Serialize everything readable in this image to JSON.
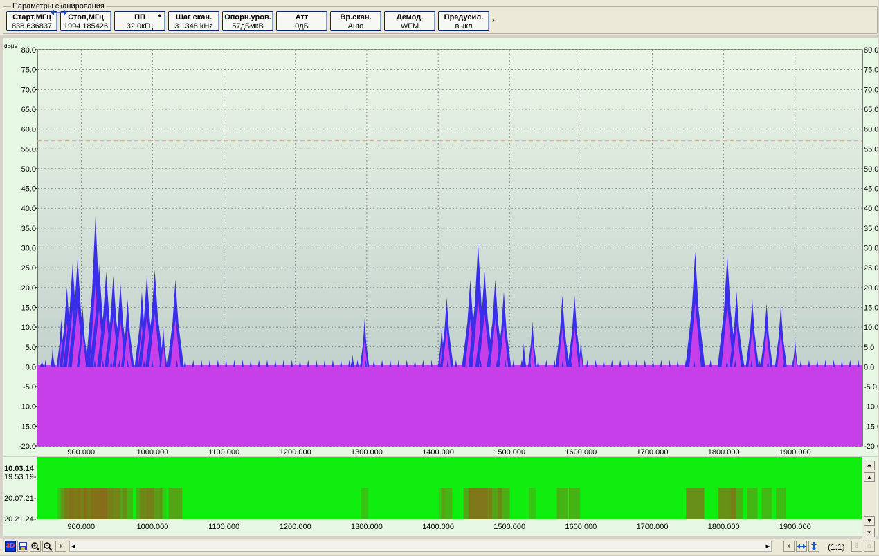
{
  "panel": {
    "title": "Параметры сканирования",
    "buttons": [
      {
        "name": "Старт,МГц",
        "value": "838.636837"
      },
      {
        "name": "Стоп,МГц",
        "value": "1994.185426"
      },
      {
        "name": "ПП",
        "value": "32.0кГц",
        "marker": "*"
      },
      {
        "name": "Шаг скан.",
        "value": "31.348 kHz"
      },
      {
        "name": "Опорн.уров.",
        "value": "57дБмкВ"
      },
      {
        "name": "Атт",
        "value": "0дБ"
      },
      {
        "name": "Вр.скан.",
        "value": "Auto"
      },
      {
        "name": "Демод.",
        "value": "WFM"
      },
      {
        "name": "Предусил.",
        "value": "выкл"
      }
    ],
    "more_glyph": "›"
  },
  "spectrum": {
    "unit": "dBµV",
    "y_ticks": [
      "80.0",
      "75.0",
      "70.0",
      "65.0",
      "60.0",
      "55.0",
      "50.0",
      "45.0",
      "40.0",
      "35.0",
      "30.0",
      "25.0",
      "20.0",
      "15.0",
      "10.0",
      "5.0",
      "0.0",
      "-5.0",
      "-10.0",
      "-15.0",
      "-20.0"
    ],
    "x_ticks": [
      "900.000",
      "1000.000",
      "1100.000",
      "1200.000",
      "1300.000",
      "1400.000",
      "1500.000",
      "1600.000",
      "1700.000",
      "1800.000",
      "1900.000"
    ],
    "reference_level": 57
  },
  "chart_data": {
    "type": "area",
    "x_unit": "MHz",
    "y_unit": "dBµV",
    "xlim": [
      838.636837,
      1994.185426
    ],
    "ylim": [
      -20,
      80
    ],
    "grid": true,
    "baseline": 0,
    "series": [
      {
        "color": "#3a2fe8",
        "peaks": [
          {
            "f": 845,
            "db": 1.5
          },
          {
            "f": 860,
            "db": 5
          },
          {
            "f": 872,
            "db": 12
          },
          {
            "f": 880,
            "db": 20
          },
          {
            "f": 888,
            "db": 26
          },
          {
            "f": 895,
            "db": 27.5
          },
          {
            "f": 902,
            "db": 15
          },
          {
            "f": 920,
            "db": 38
          },
          {
            "f": 925,
            "db": 26
          },
          {
            "f": 935,
            "db": 24
          },
          {
            "f": 945,
            "db": 23
          },
          {
            "f": 955,
            "db": 21
          },
          {
            "f": 965,
            "db": 17
          },
          {
            "f": 985,
            "db": 19
          },
          {
            "f": 992,
            "db": 23
          },
          {
            "f": 1003,
            "db": 24.5
          },
          {
            "f": 1015,
            "db": 10
          },
          {
            "f": 1032,
            "db": 22
          },
          {
            "f": 1280,
            "db": 3
          },
          {
            "f": 1297,
            "db": 12
          },
          {
            "f": 1405,
            "db": 10
          },
          {
            "f": 1412,
            "db": 17.5
          },
          {
            "f": 1445,
            "db": 22
          },
          {
            "f": 1456,
            "db": 31
          },
          {
            "f": 1465,
            "db": 24
          },
          {
            "f": 1480,
            "db": 22
          },
          {
            "f": 1492,
            "db": 19
          },
          {
            "f": 1520,
            "db": 6
          },
          {
            "f": 1532,
            "db": 11.5
          },
          {
            "f": 1574,
            "db": 18
          },
          {
            "f": 1591,
            "db": 18
          },
          {
            "f": 1600,
            "db": 7
          },
          {
            "f": 1760,
            "db": 29
          },
          {
            "f": 1805,
            "db": 28
          },
          {
            "f": 1818,
            "db": 19
          },
          {
            "f": 1840,
            "db": 17
          },
          {
            "f": 1860,
            "db": 16
          },
          {
            "f": 1880,
            "db": 15.5
          },
          {
            "f": 1900,
            "db": 7
          }
        ]
      }
    ]
  },
  "waterfall": {
    "date": "10.03.14",
    "times": [
      "19.53.19-",
      "20.07.21-",
      "20.21.24-"
    ],
    "x_ticks": [
      "900.000",
      "1000.000",
      "1100.000",
      "1200.000",
      "1300.000",
      "1400.000",
      "1500.000",
      "1600.000",
      "1700.000",
      "1800.000",
      "1900.000"
    ]
  },
  "toolbar": {
    "btn_3d": "3D",
    "zoom_ratio": "(1:1)",
    "first_page": "«",
    "prev": "◂",
    "next": "▸",
    "last_page": "»"
  },
  "colors": {
    "spectrum_bg": "#e6f7e3",
    "plot_bg_top": "#eaf5e6",
    "plot_bg_bottom": "#b9c9c6",
    "signal_blue": "#3a2fe8",
    "signal_magenta": "#c63fe8",
    "waterfall_green": "#10ee10",
    "ref_line": "#f0a060"
  }
}
